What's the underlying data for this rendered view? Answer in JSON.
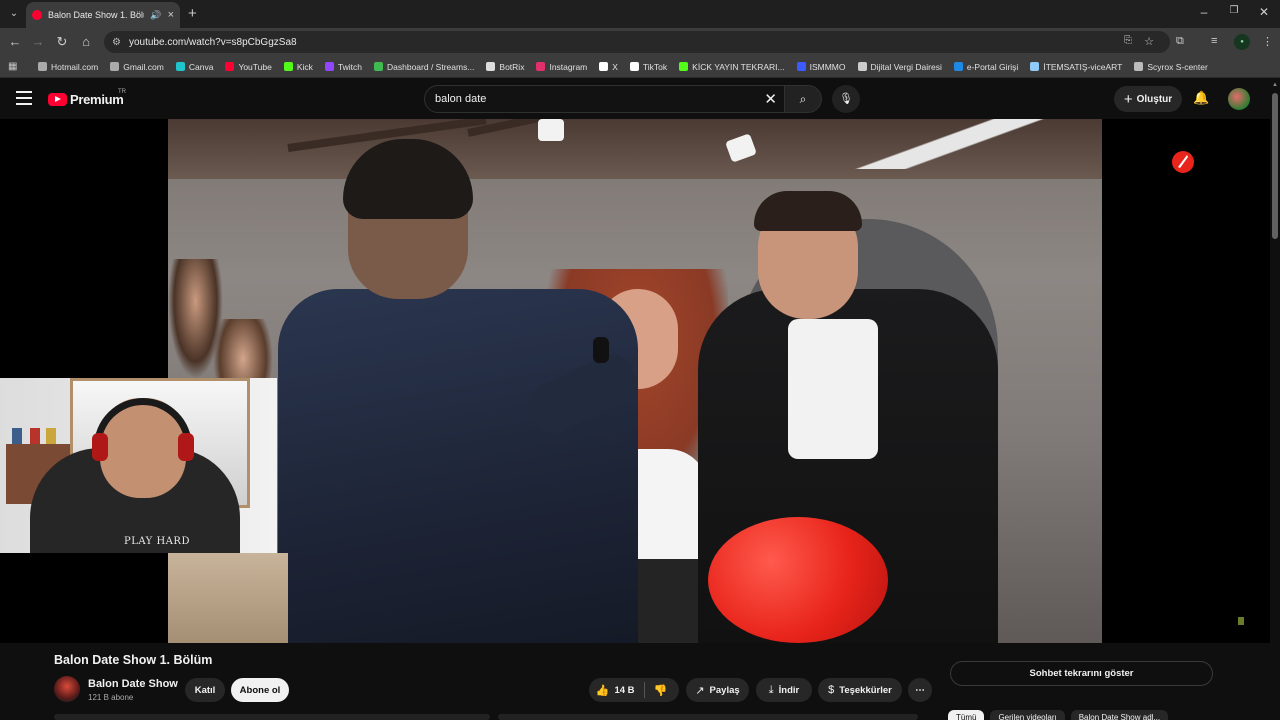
{
  "browser": {
    "tab": {
      "title": "Balon Date Show 1. Bölüm"
    },
    "url": "youtube.com/watch?v=s8pCbGgzSa8",
    "bookmarks": [
      {
        "label": "Hotmail.com",
        "color": "#aaaaaa"
      },
      {
        "label": "Gmail.com",
        "color": "#aaaaaa"
      },
      {
        "label": "Canva",
        "color": "#20c4cb"
      },
      {
        "label": "YouTube",
        "color": "#ff0033"
      },
      {
        "label": "Kick",
        "color": "#53fc18"
      },
      {
        "label": "Twitch",
        "color": "#9146ff"
      },
      {
        "label": "Dashboard / Streams...",
        "color": "#3fb950"
      },
      {
        "label": "BotRix",
        "color": "#dddddd"
      },
      {
        "label": "Instagram",
        "color": "#e1306c"
      },
      {
        "label": "X",
        "color": "#ffffff"
      },
      {
        "label": "TikTok",
        "color": "#ffffff"
      },
      {
        "label": "KİCK YAYIN TEKRARI...",
        "color": "#53fc18"
      },
      {
        "label": "ISMMMO",
        "color": "#3d5afe"
      },
      {
        "label": "Dijital Vergi Dairesi",
        "color": "#cccccc"
      },
      {
        "label": "e-Portal Girişi",
        "color": "#1e88e5"
      },
      {
        "label": "İTEMSATIŞ-viceART",
        "color": "#90caf9"
      },
      {
        "label": "Scyrox S-center",
        "color": "#bbbbbb"
      }
    ]
  },
  "youtube": {
    "logo": {
      "label": "Premium",
      "country": "TR"
    },
    "search": {
      "query": "balon date"
    },
    "create_label": "Oluştur",
    "webcam_shirt_text": "PLAY HARD",
    "video": {
      "title": "Balon Date Show 1. Bölüm",
      "channel": {
        "name": "Balon Date Show",
        "subscribers": "121 B abone"
      },
      "join_label": "Katıl",
      "subscribe_label": "Abone ol",
      "likes": "14 B",
      "share_label": "Paylaş",
      "download_label": "İndir",
      "thanks_label": "Teşekkürler"
    },
    "sidebar": {
      "chat_replay_label": "Sohbet tekrarını göster",
      "chips": [
        "Tümü",
        "Gerilen videoları",
        "Balon Date Show adl..."
      ]
    }
  },
  "colors": {
    "accent_red": "#ff0033",
    "background": "#0f0f0f"
  }
}
